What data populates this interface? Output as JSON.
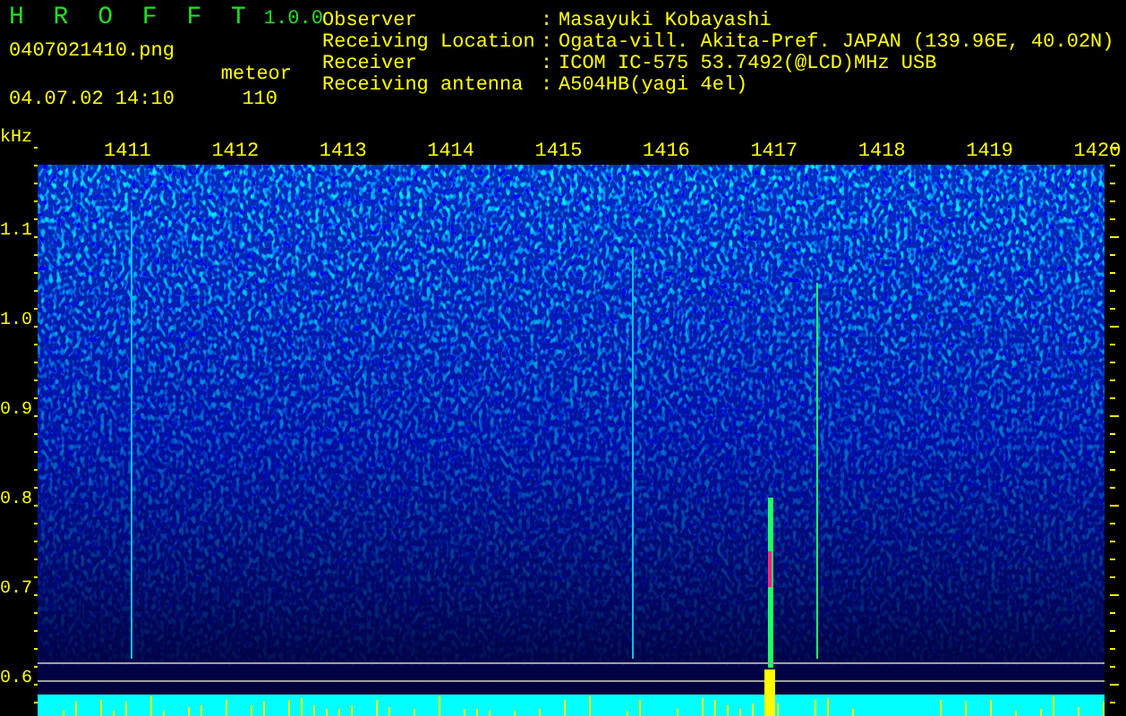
{
  "app": {
    "name": "H R O F F T",
    "version": "1.0.0"
  },
  "file_name": "0407021410.png",
  "timestamp": "04.07.02 14:10",
  "counter": {
    "label": "meteor",
    "value": "110"
  },
  "info": [
    {
      "label": "Observer",
      "colon": ":",
      "value": "Masayuki Kobayashi"
    },
    {
      "label": "Receiving Location",
      "colon": ":",
      "value": "Ogata-vill. Akita-Pref. JAPAN (139.96E, 40.02N)"
    },
    {
      "label": "Receiver",
      "colon": ":",
      "value": "ICOM IC-575 53.7492(@LCD)MHz USB"
    },
    {
      "label": "Receiving antenna",
      "colon": ":",
      "value": "A504HB(yagi 4el)"
    }
  ],
  "frequency_axis": {
    "unit": "kHz",
    "labels": [
      "1.1",
      "1.0",
      "0.9",
      "0.8",
      "0.7",
      "0.6"
    ]
  },
  "time_labels": [
    "1411",
    "1412",
    "1413",
    "1414",
    "1415",
    "1416",
    "1417",
    "1418",
    "1419",
    "1420"
  ]
}
